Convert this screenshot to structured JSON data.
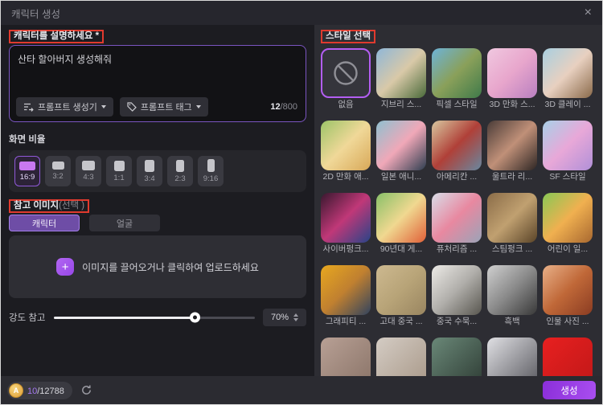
{
  "colors": {
    "accent_purple": "#9b5cf0",
    "annotation_red": "#e03a2e",
    "generate_gradient_start": "#8b2fd9",
    "generate_gradient_end": "#a94ef0",
    "coin_gold": "#e8b04a",
    "panel_left_bg": "#1c1c21",
    "panel_right_bg": "#2d2d33"
  },
  "window": {
    "title": "캐릭터 생성",
    "close_label": "×"
  },
  "prompt": {
    "label": "캐릭터를 설명하세요 *",
    "value": "산타 할아버지 생성해줘",
    "generator_button": "프롬프트 생성기",
    "tag_button": "프롬프트 태그",
    "char_count": "12",
    "char_limit": "/800"
  },
  "aspect_ratio": {
    "label": "화면 비율",
    "options": [
      {
        "label": "16:9",
        "selected": true
      },
      {
        "label": "3:2",
        "selected": false
      },
      {
        "label": "4:3",
        "selected": false
      },
      {
        "label": "1:1",
        "selected": false
      },
      {
        "label": "3:4",
        "selected": false
      },
      {
        "label": "2:3",
        "selected": false
      },
      {
        "label": "9:16",
        "selected": false
      }
    ]
  },
  "reference_image": {
    "label": "참고 이미지",
    "optional_label": "(선택 )",
    "tabs": [
      {
        "label": "캐릭터",
        "selected": true
      },
      {
        "label": "얼굴",
        "selected": false
      }
    ],
    "plus_label": "+",
    "upload_text": "이미지를 끌어오거나 클릭하여 업로드하세요",
    "strength_label": "강도 참고",
    "strength_percent": 70,
    "strength_display": "70%"
  },
  "style_picker": {
    "label": "스타일 선택",
    "items": [
      {
        "label": "없음",
        "selected": true,
        "kind": "none"
      },
      {
        "label": "지브리 스...",
        "colors": [
          "#8fb7d8",
          "#d9c9a8",
          "#4a6a3a"
        ]
      },
      {
        "label": "픽셀 스타일",
        "colors": [
          "#6db3d8",
          "#8aa05a",
          "#3f7a4a"
        ]
      },
      {
        "label": "3D 만화 스...",
        "colors": [
          "#f0c8e0",
          "#e8a6cc",
          "#b87fc0"
        ]
      },
      {
        "label": "3D 클레이 ...",
        "colors": [
          "#a8cfe0",
          "#e8d0c0",
          "#8a6a4a"
        ]
      },
      {
        "label": "2D 만화 애...",
        "colors": [
          "#9cc468",
          "#f0d898",
          "#d8a858"
        ]
      },
      {
        "label": "일본 애니...",
        "colors": [
          "#8fc0d0",
          "#f0a8b8",
          "#2e3e50"
        ]
      },
      {
        "label": "아메리칸 ...",
        "colors": [
          "#d8c8a0",
          "#b04038",
          "#6888a0"
        ]
      },
      {
        "label": "울트라 리...",
        "colors": [
          "#4a3c38",
          "#c09078",
          "#2e2624"
        ]
      },
      {
        "label": "SF 스타일",
        "colors": [
          "#a8d0e8",
          "#e8a8d8",
          "#b090d8"
        ]
      },
      {
        "label": "사이버펑크...",
        "colors": [
          "#38182e",
          "#c03878",
          "#284488"
        ]
      },
      {
        "label": "90년대 게...",
        "colors": [
          "#88c068",
          "#f0d890",
          "#e06038"
        ]
      },
      {
        "label": "퓨처리즘 ...",
        "colors": [
          "#d8dde8",
          "#e888a0",
          "#9aa4b8"
        ]
      },
      {
        "label": "스팀펑크 ...",
        "colors": [
          "#8a6c48",
          "#c0a070",
          "#5a4428"
        ]
      },
      {
        "label": "어린이 일...",
        "colors": [
          "#88c855",
          "#f0b050",
          "#a86830"
        ]
      },
      {
        "label": "그래피티 ...",
        "colors": [
          "#e8a81f",
          "#c08030",
          "#32435e"
        ]
      },
      {
        "label": "고대 중국 ...",
        "colors": [
          "#cdb990",
          "#b8a478",
          "#998560"
        ]
      },
      {
        "label": "중국 수묵...",
        "colors": [
          "#eceae6",
          "#b0aeaa",
          "#58564f"
        ]
      },
      {
        "label": "흑백",
        "colors": [
          "#d0d0d0",
          "#8a8a8a",
          "#383838"
        ]
      },
      {
        "label": "인물 사진 ...",
        "colors": [
          "#e8b088",
          "#c06838",
          "#8a3c22"
        ]
      },
      {
        "colors": [
          "#b8a095",
          "#8a7468"
        ]
      },
      {
        "colors": [
          "#d4ccc4",
          "#a89888"
        ]
      },
      {
        "colors": [
          "#6a8878",
          "#2e3c34"
        ]
      },
      {
        "colors": [
          "#e0e0e4",
          "#58585e"
        ]
      },
      {
        "colors": [
          "#e82020",
          "#c01818"
        ]
      }
    ]
  },
  "footer": {
    "coin_label": "A",
    "credits_used": "10",
    "credits_total": "/12788",
    "generate_label": "생성"
  }
}
